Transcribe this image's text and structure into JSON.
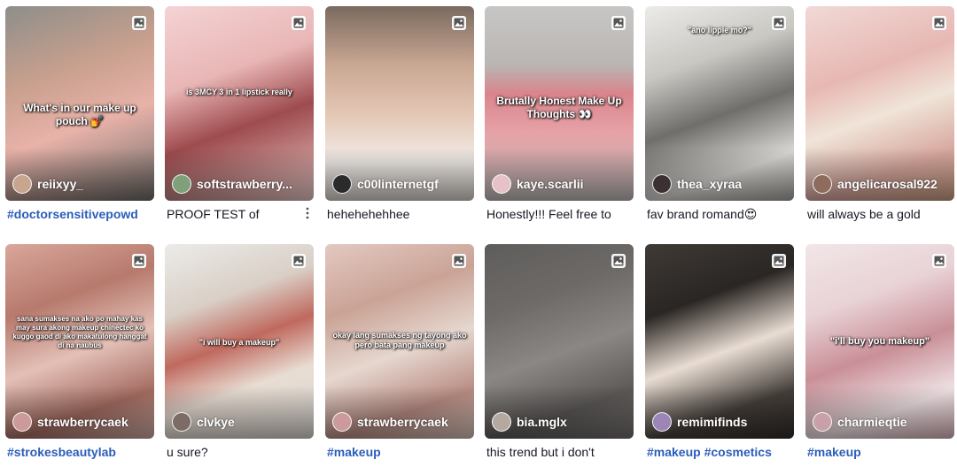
{
  "cards": [
    {
      "author": "reiixyy_",
      "caption": "#doctorsensitivepowd",
      "caption_is_tag": true,
      "overlay": "What's in our make up pouch 💅",
      "bg": "linear-gradient(160deg,#8d8e8a 0%,#c9a08e 35%,#e8b2a9 60%,#6c6a66 100%)",
      "avatar_color": "#c7a58f"
    },
    {
      "author": "softstrawberry...",
      "caption": "PROOF TEST of",
      "caption_is_tag": false,
      "overlay": "is 3MCY 3 in 1 lipstick really",
      "bg": "linear-gradient(160deg,#f4d3d4 0%,#e9b6b6 35%,#9e4b4e 60%,#e9c9c6 100%)",
      "avatar_color": "#7fa07a",
      "has_more": true
    },
    {
      "author": "c00linternetgf",
      "caption": "hehehehehhee",
      "caption_is_tag": false,
      "overlay": "",
      "bg": "linear-gradient(180deg,#7a6a5f 0%,#c9a793 30%,#e4c6b4 55%,#f1ece8 80%,#d9d2cc 100%)",
      "avatar_color": "#2b2b2b"
    },
    {
      "author": "kaye.scarlii",
      "caption": "Honestly!!! Feel free to",
      "caption_is_tag": false,
      "overlay": "Brutally Honest Make Up Thoughts 👀",
      "bg": "linear-gradient(180deg,#c8c6c4 0%,#b9b6b4 30%,#d9858c 45%,#e6a2a7 65%,#bcb9b7 100%)",
      "avatar_color": "#e6c2c8"
    },
    {
      "author": "thea_xyraa",
      "caption": "fav brand romand😍",
      "caption_is_tag": false,
      "overlay": "\"ano lippie mo?\"",
      "bg": "linear-gradient(160deg,#ecebe8 0%,#c9c7c2 30%,#6f6e6b 55%,#dad8d4 80%,#a5a39f 100%)",
      "avatar_color": "#3b3032"
    },
    {
      "author": "angelicarosal922",
      "caption": "will always be a gold",
      "caption_is_tag": false,
      "overlay": "",
      "bg": "linear-gradient(160deg,#f1d9d6 0%,#e7b8b3 35%,#f0e4d8 55%,#d7a69d 80%,#c89f82 100%)",
      "avatar_color": "#8f6b5e"
    },
    {
      "author": "strawberrycaek",
      "caption": "#strokesbeautylab",
      "caption_is_tag": true,
      "overlay": "sana sumakses na ako po mahay kas may sura akong makeup chinectec ko kuggo gaod di ako makatulong hanggat di na naubus",
      "bg": "linear-gradient(160deg,#d9a79b 0%,#b77a6d 30%,#e3c0b7 55%,#a56c62 80%,#cdaea5 100%)",
      "avatar_color": "#cc9a9a"
    },
    {
      "author": "clvkye",
      "caption": "u sure?",
      "caption_is_tag": false,
      "overlay": "\"i will buy a makeup\"",
      "bg": "linear-gradient(160deg,#ecebe9 0%,#d9cfc6 30%,#c0695e 50%,#e8ddd3 70%,#d8d3ce 100%)",
      "avatar_color": "#7b6d66"
    },
    {
      "author": "strawberrycaek",
      "caption": "#makeup",
      "caption_is_tag": true,
      "overlay": "okay lang sumakses ng tayong ako pero bata pang makeup",
      "bg": "linear-gradient(160deg,#e3c9c2 0%,#caa396 30%,#e6d7cf 55%,#b98d84 80%,#d8c3ba 100%)",
      "avatar_color": "#cc9a9a"
    },
    {
      "author": "bia.mglx",
      "caption": "this trend but i don't",
      "caption_is_tag": false,
      "overlay": "",
      "bg": "linear-gradient(160deg,#5f5d5b 0%,#6d6a68 30%,#8b8784 55%,#5c5957 80%,#74706d 100%)",
      "avatar_color": "#b5a8a0"
    },
    {
      "author": "remimifinds",
      "caption": "#makeup #cosmetics",
      "caption_is_tag": true,
      "overlay": "",
      "bg": "linear-gradient(160deg,#3f3a36 0%,#2a2623 30%,#e9ddd3 55%,#46403b 80%,#312c29 100%)",
      "avatar_color": "#9b86b6"
    },
    {
      "author": "charmieqtie",
      "caption": "#makeup",
      "caption_is_tag": true,
      "overlay": "\"i'll buy you makeup\"",
      "bg": "linear-gradient(160deg,#f2e6e7 0%,#e8d2d6 30%,#c98f97 55%,#efe2e4 80%,#d9b4ba 100%)",
      "avatar_color": "#c7a0a8"
    }
  ],
  "photo_icon": "image-icon",
  "more_icon": "more-vertical-icon",
  "colors": {
    "tag": "#2b5db9",
    "text": "#161823"
  }
}
